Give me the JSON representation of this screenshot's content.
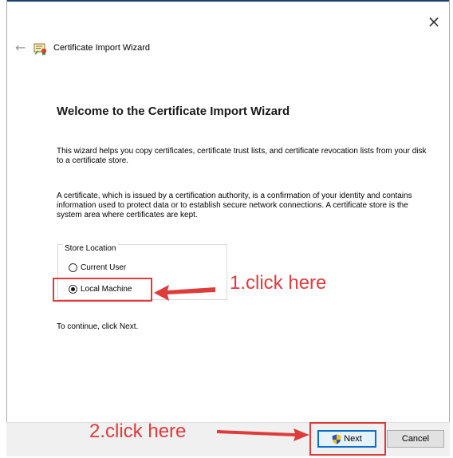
{
  "window": {
    "close_glyph": "×"
  },
  "header": {
    "back_glyph": "←",
    "icon": "certificate-icon",
    "title": "Certificate Import Wizard"
  },
  "main": {
    "heading": "Welcome to the Certificate Import Wizard",
    "paragraph1": "This wizard helps you copy certificates, certificate trust lists, and certificate revocation lists from your disk to a certificate store.",
    "paragraph2": "A certificate, which is issued by a certification authority, is a confirmation of your identity and contains information used to protect data or to establish secure network connections. A certificate store is the system area where certificates are kept.",
    "store_location": {
      "legend": "Store Location",
      "options": [
        {
          "label": "Current User",
          "selected": false
        },
        {
          "label": "Local Machine",
          "selected": true
        }
      ]
    },
    "continue_text": "To continue, click Next."
  },
  "annotations": {
    "step1": "1.click here",
    "step2": "2.click here",
    "color": "#e03b3b"
  },
  "footer": {
    "next_label": "Next",
    "cancel_label": "Cancel",
    "next_icon": "uac-shield-icon"
  }
}
